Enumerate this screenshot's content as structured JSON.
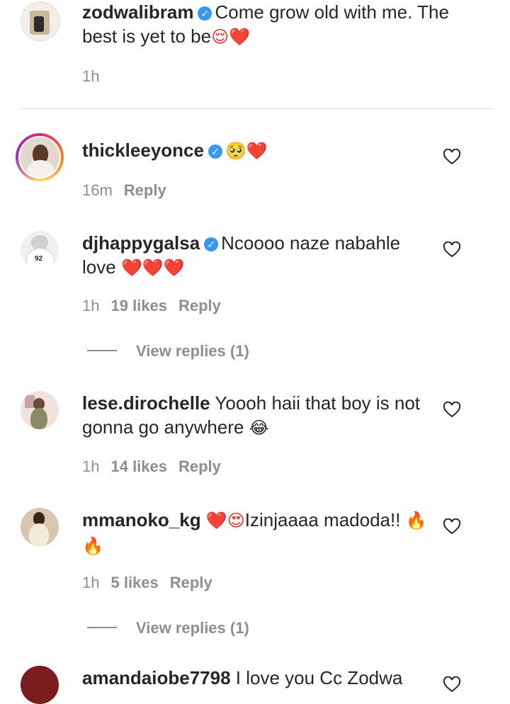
{
  "caption": {
    "username": "zodwalibram",
    "text": "Come grow old with me. The best is yet to be",
    "emojis": "😌❤️",
    "time": "1h"
  },
  "comments": [
    {
      "username": "thickleeyonce",
      "text": "",
      "emojis": "🥺❤️",
      "time": "16m",
      "likes": "",
      "reply": "Reply"
    },
    {
      "username": "djhappygalsa",
      "text": "Ncoooo naze nabahle love",
      "emojis": "❤️❤️❤️",
      "time": "1h",
      "likes": "19 likes",
      "reply": "Reply",
      "view_replies": "View replies (1)"
    },
    {
      "username": "lese.dirochelle",
      "text": "Yoooh haii that boy is not gonna go anywhere",
      "emojis": "😂",
      "time": "1h",
      "likes": "14 likes",
      "reply": "Reply"
    },
    {
      "username": "mmanoko_kg",
      "text": "Izinjaaaa madoda!!",
      "emojis_before": "❤️😍",
      "emojis": "🔥🔥",
      "time": "1h",
      "likes": "5 likes",
      "reply": "Reply",
      "view_replies": "View replies (1)"
    },
    {
      "username": "amandaiobe7798",
      "text": "I love you Cc Zodwa"
    }
  ],
  "icons": {
    "verified": "verified-badge-icon",
    "like": "heart-outline-icon"
  },
  "colors": {
    "verified": "#3897f0",
    "muted": "#8e8e8e",
    "heart": "#ed2e2e"
  }
}
